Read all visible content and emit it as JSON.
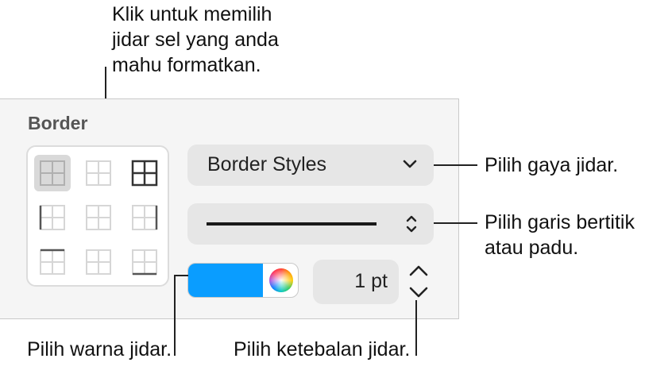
{
  "callouts": {
    "cell_borders": [
      "Klik untuk memilih",
      "jidar sel yang anda",
      "mahu formatkan."
    ],
    "border_style": "Pilih gaya jidar.",
    "line_style": [
      "Pilih garis bertitik",
      "atau padu."
    ],
    "border_color": "Pilih warna jidar.",
    "border_thickness": "Pilih ketebalan jidar."
  },
  "panel": {
    "title": "Border",
    "border_styles_label": "Border Styles",
    "line_style": "solid",
    "color": "#0A9DFF",
    "thickness": "1 pt"
  },
  "border_options": [
    "all-borders",
    "inside-borders",
    "outside-borders",
    "left-border",
    "vertical-inside-borders",
    "right-border",
    "top-border",
    "horizontal-inside-borders",
    "bottom-border"
  ],
  "selected_border_option": "all-borders"
}
